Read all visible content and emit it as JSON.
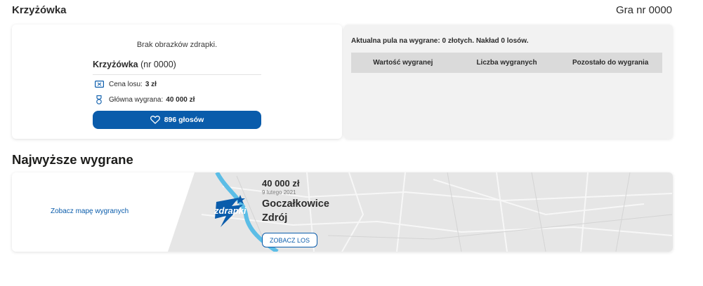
{
  "header": {
    "title": "Krzyżówka",
    "game_number": "Gra nr 0000"
  },
  "ticket": {
    "no_images": "Brak obrazków zdrapki.",
    "name": "Krzyżówka",
    "number": "(nr 0000)",
    "price_label": "Cena losu:",
    "price_value": "3 zł",
    "prize_label": "Główna wygrana:",
    "prize_value": "40 000 zł",
    "votes": "896 głosów"
  },
  "pool": {
    "text": "Aktualna pula na wygrane: 0 złotych. Nakład 0 losów.",
    "columns": [
      "Wartość wygranej",
      "Liczba wygranych",
      "Pozostało do wygrania"
    ]
  },
  "top_wins": {
    "title": "Najwyższe wygrane",
    "map_link": "Zobacz mapę wygranych",
    "logo_text": "zdrapki",
    "amount": "40 000 zł",
    "date": "9 lutego 2021",
    "city": "Goczałkowice Zdrój",
    "button": "ZOBACZ LOS"
  },
  "colors": {
    "accent": "#0a5cab",
    "river": "#5bbde6",
    "map": "#e6e6e6"
  }
}
